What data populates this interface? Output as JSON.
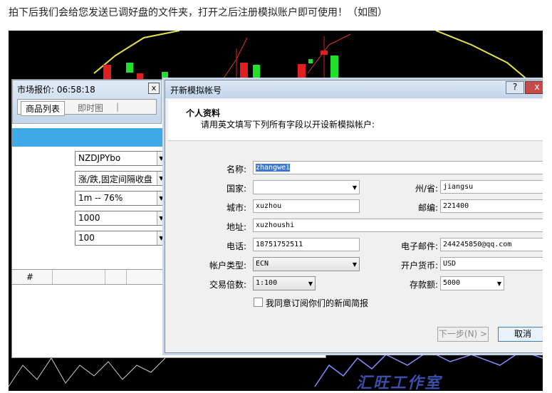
{
  "intro_text": "拍下后我们会给您发送已调好盘的文件夹，打开之后注册模拟账户即可使用！（如图）",
  "watermark": "汇旺工作室",
  "market_watch": {
    "title": "市场报价: 06:58:18",
    "close": "x",
    "tabs": [
      "商品列表",
      "即时图"
    ],
    "selects": [
      "NZDJPYbo",
      "涨/跌,固定间隔收盘",
      "1m  --  76%",
      "1000",
      "100"
    ],
    "grid_header": "#"
  },
  "dialog": {
    "title": "开新模拟帐号",
    "help": "?",
    "close": "x",
    "section_title": "个人资料",
    "section_sub": "请用英文填写下列所有字段以开设新模拟帐户:",
    "fields": {
      "name_label": "名称:",
      "name_value": "zhangwei",
      "country_label": "国家:",
      "country_value": "",
      "state_label": "州/省:",
      "state_value": "jiangsu",
      "city_label": "城市:",
      "city_value": "xuzhou",
      "zip_label": "邮编:",
      "zip_value": "221400",
      "address_label": "地址:",
      "address_value": "xuzhoushi",
      "phone_label": "电话:",
      "phone_value": "18751752511",
      "email_label": "电子邮件:",
      "email_value": "244245850@qq.com",
      "account_type_label": "帐户类型:",
      "account_type_value": "ECN",
      "currency_label": "开户货币:",
      "currency_value": "USD",
      "leverage_label": "交易倍数:",
      "leverage_value": "1:100",
      "deposit_label": "存款额:",
      "deposit_value": "5000"
    },
    "newsletter_label": "我同意订阅你们的新闻简报",
    "next_button": "下一步(N) >",
    "cancel_button": "取消"
  }
}
